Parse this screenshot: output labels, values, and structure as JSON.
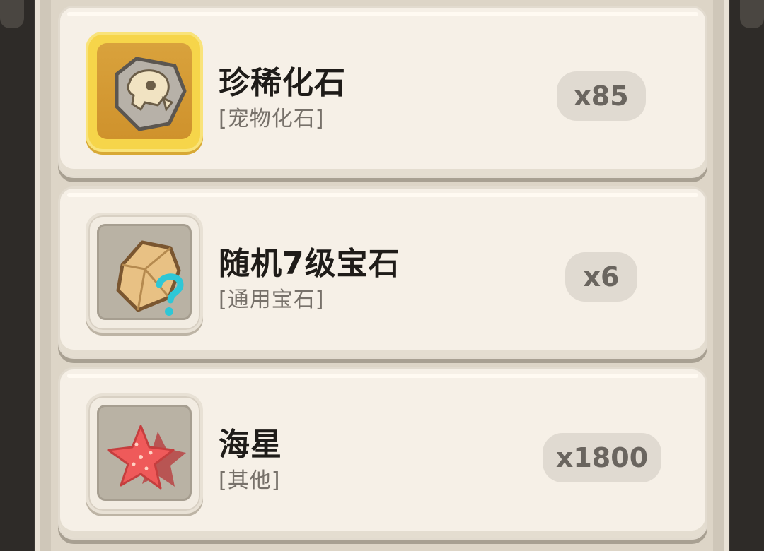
{
  "items": [
    {
      "name": "珍稀化石",
      "category": "[宠物化石]",
      "quantity": "x85",
      "icon": "fossil-icon",
      "frame": "gold"
    },
    {
      "name": "随机7级宝石",
      "category": "[通用宝石]",
      "quantity": "x6",
      "icon": "gem-question-icon",
      "frame": "grey"
    },
    {
      "name": "海星",
      "category": "[其他]",
      "quantity": "x1800",
      "icon": "starfish-icon",
      "frame": "grey"
    }
  ],
  "colors": {
    "gold_frame": "#f6d54a",
    "card_bg": "#f6f0e7",
    "qty_badge": "#e0dad1"
  }
}
